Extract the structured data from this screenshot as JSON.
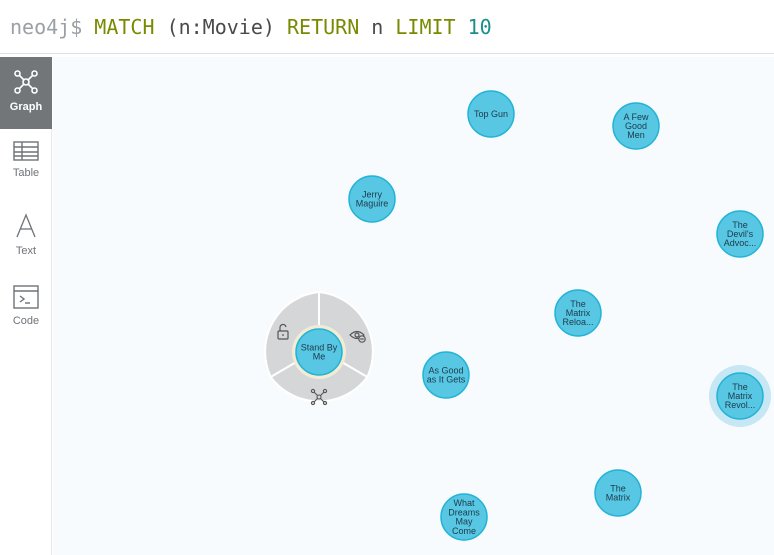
{
  "query": {
    "prompt": "neo4j$",
    "parts": [
      {
        "text": "MATCH",
        "kind": "kw"
      },
      {
        "text": "(n:Movie)",
        "kind": "txt"
      },
      {
        "text": "RETURN",
        "kind": "kw"
      },
      {
        "text": "n",
        "kind": "txt"
      },
      {
        "text": "LIMIT",
        "kind": "kw"
      },
      {
        "text": "10",
        "kind": "num"
      }
    ]
  },
  "sidebar": {
    "items": [
      {
        "label": "Graph",
        "icon": "graph-icon",
        "active": true
      },
      {
        "label": "Table",
        "icon": "table-icon",
        "active": false
      },
      {
        "label": "Text",
        "icon": "text-icon",
        "active": false
      },
      {
        "label": "Code",
        "icon": "code-icon",
        "active": false
      }
    ]
  },
  "graph": {
    "node_fill": "#57c7e3",
    "node_stroke": "#23b3d7",
    "nodes": [
      {
        "id": "top-gun",
        "lines": [
          "Top Gun"
        ]
      },
      {
        "id": "a-few-good-men",
        "lines": [
          "A Few",
          "Good",
          "Men"
        ]
      },
      {
        "id": "jerry-maguire",
        "lines": [
          "Jerry",
          "Maguire"
        ]
      },
      {
        "id": "the-devils-advocate",
        "lines": [
          "The",
          "Devil's",
          "Advoc..."
        ]
      },
      {
        "id": "the-matrix-reloaded",
        "lines": [
          "The",
          "Matrix",
          "Reloa..."
        ]
      },
      {
        "id": "stand-by-me",
        "lines": [
          "Stand By",
          "Me"
        ],
        "selected": true
      },
      {
        "id": "as-good-as-it-gets",
        "lines": [
          "As Good",
          "as It Gets"
        ]
      },
      {
        "id": "the-matrix-revolutions",
        "lines": [
          "The",
          "Matrix",
          "Revol..."
        ],
        "hovered": true
      },
      {
        "id": "the-matrix",
        "lines": [
          "The",
          "Matrix"
        ]
      },
      {
        "id": "what-dreams-may-come",
        "lines": [
          "What",
          "Dreams",
          "May",
          "Come"
        ]
      }
    ],
    "ring_actions": [
      {
        "name": "unlock-icon"
      },
      {
        "name": "hide-icon"
      },
      {
        "name": "expand-icon"
      }
    ]
  }
}
